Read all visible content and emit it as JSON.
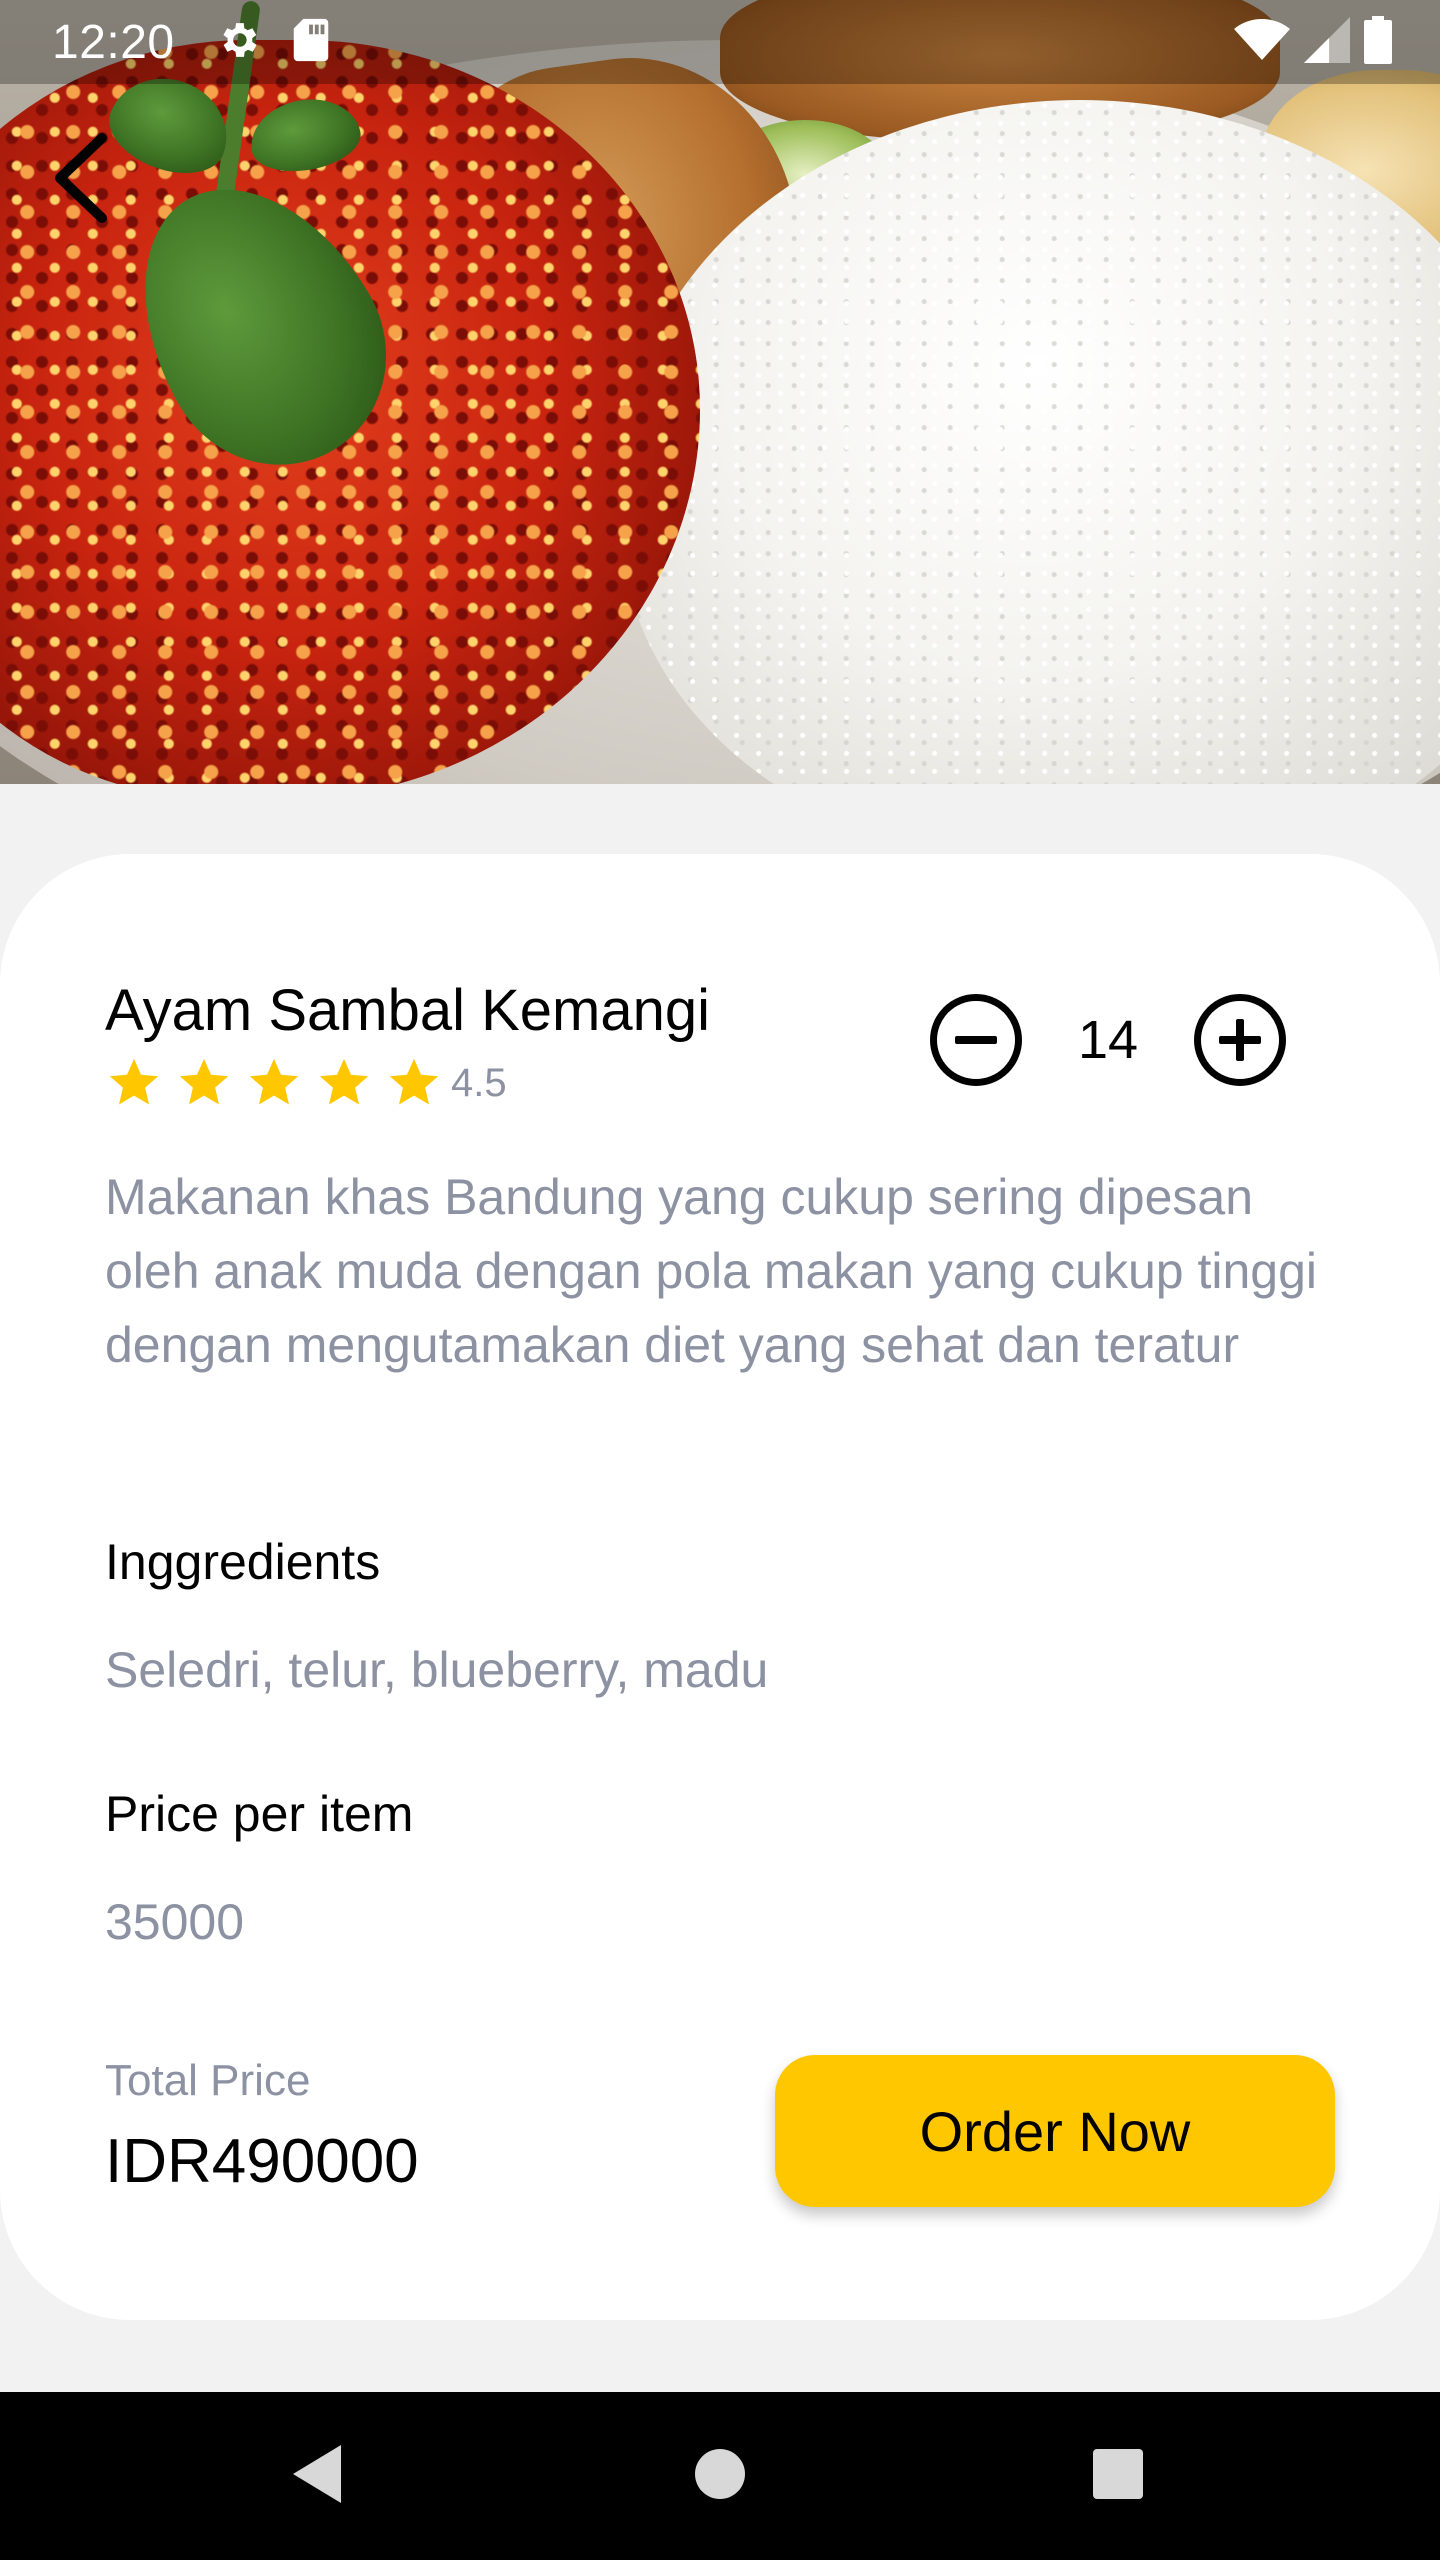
{
  "status_bar": {
    "time": "12:20",
    "icons": [
      "gear-icon",
      "sd-card-icon",
      "wifi-icon",
      "signal-icon",
      "battery-icon"
    ]
  },
  "hero": {
    "image_subject": "ayam sambal kemangi with rice",
    "back_icon": "chevron-left-icon"
  },
  "food": {
    "name": "Ayam Sambal Kemangi",
    "rating": 4.5,
    "rating_label": "4.5",
    "star_count": 5,
    "quantity": "14",
    "description": "Makanan khas Bandung yang cukup sering dipesan oleh anak muda dengan pola makan yang cukup tinggi dengan mengutamakan diet yang sehat dan teratur"
  },
  "ingredients": {
    "title": "Inggredients",
    "value": "Seledri, telur, blueberry, madu"
  },
  "price": {
    "title": "Price per item",
    "value": "35000"
  },
  "total": {
    "label": "Total Price",
    "value": "IDR490000"
  },
  "order_button": {
    "label": "Order Now"
  },
  "colors": {
    "accent": "#FFC700",
    "star": "#FFC700",
    "text_primary": "#020202",
    "text_secondary": "#8D92A3",
    "background": "#F2F2F2",
    "card": "#FFFFFF"
  },
  "nav_bar": {
    "icons": [
      "nav-back-icon",
      "nav-home-icon",
      "nav-recents-icon"
    ]
  }
}
